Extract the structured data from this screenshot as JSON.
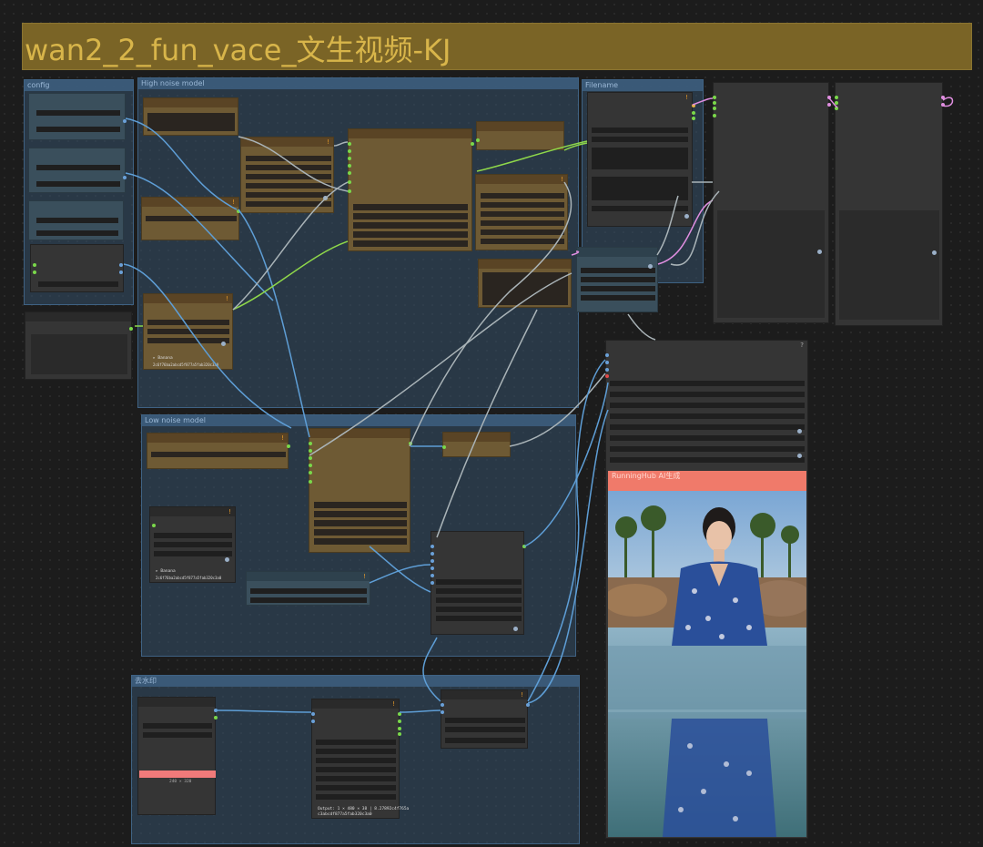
{
  "workflow": {
    "title": "wan2_2_fun_vace_文生视频-KJ"
  },
  "groups": {
    "config": "config",
    "high_noise": "High noise model",
    "low_noise": "Low noise model",
    "watermark": "去水印",
    "filename": "Filename"
  },
  "notes": {
    "high_hash_title": "▸ Banana",
    "high_hash": "2c6f76ba2abcd5f877a5fab320c3a0",
    "low_hash_title": "▸ Banana",
    "low_hash": "2c6f76ba2abcd5f877a5fab320c3a0",
    "output_summary_line1": "Output: 1 × 480 × 38 | 8.27892c4f765a",
    "output_summary_line2": "c3abcdf877a5fab320c3a0",
    "mask_dims": "240 × 320"
  },
  "preview": {
    "header": "RunningHub AI生成"
  },
  "colors": {
    "accent_title": "#d8b54a",
    "group_bg": "#345069",
    "node_brown": "#6e5a34",
    "wire_blue": "#5e9ed6",
    "wire_green": "#8fd84a",
    "wire_pink": "#e08ee0",
    "preview_header": "#f07a6a"
  }
}
